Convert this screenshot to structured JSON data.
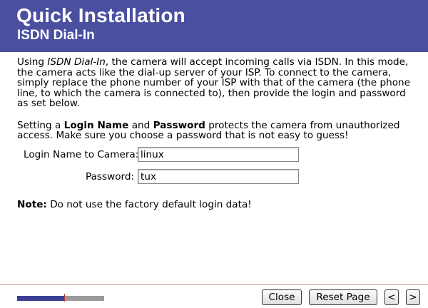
{
  "header": {
    "title": "Quick Installation",
    "subtitle": "ISDN Dial-In"
  },
  "intro": {
    "prefix": "Using ",
    "term": "ISDN Dial-In",
    "rest": ", the camera will accept incoming calls via ISDN. In this mode, the camera acts like the dial-up server of your ISP. To connect to the camera, simply replace the phone number of your ISP with that of the camera (the phone line, to which the camera is connected to), then provide the login and password as set below."
  },
  "security": {
    "part1": "Setting a ",
    "login_term": "Login Name",
    "part2": " and ",
    "password_term": "Password",
    "part3": " protects the camera from unauthorized access. Make sure you choose a password that is not easy to guess!"
  },
  "form": {
    "login_label": "Login Name to Camera:",
    "login_value": "linux",
    "password_label": "Password:",
    "password_value": "tux"
  },
  "note": {
    "label": "Note:",
    "text": " Do not use the factory default login data!"
  },
  "footer": {
    "progress_fraction": 0.54,
    "close_label": "Close",
    "reset_label": "Reset Page",
    "prev_label": "<",
    "next_label": ">"
  },
  "colors": {
    "header_bg": "#4a4fa0",
    "progress_fill": "#3b3f94",
    "progress_track": "#9a9a9a",
    "progress_marker": "#c0392b"
  }
}
